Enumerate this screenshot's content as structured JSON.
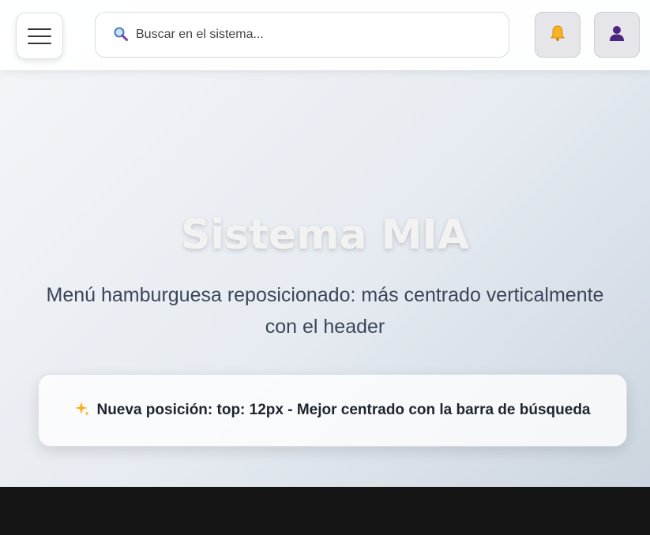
{
  "header": {
    "menu_icon": "hamburger-menu-icon",
    "search": {
      "placeholder": "Buscar en el sistema...",
      "value": "",
      "icon": "search-icon"
    },
    "notifications_icon": "bell-icon",
    "profile_icon": "user-icon"
  },
  "hero": {
    "title": "Sistema MIA",
    "subtitle": "Menú hamburguesa reposicionado: más centrado verticalmente con el header"
  },
  "notice": {
    "icon": "sparkles-icon",
    "text": "Nueva posición: top: 12px - Mejor centrado con la barra de búsqueda"
  },
  "colors": {
    "background_start": "#f4f6f9",
    "background_end": "#ccd5df",
    "footer": "#141414",
    "user_icon": "#4b2680"
  }
}
